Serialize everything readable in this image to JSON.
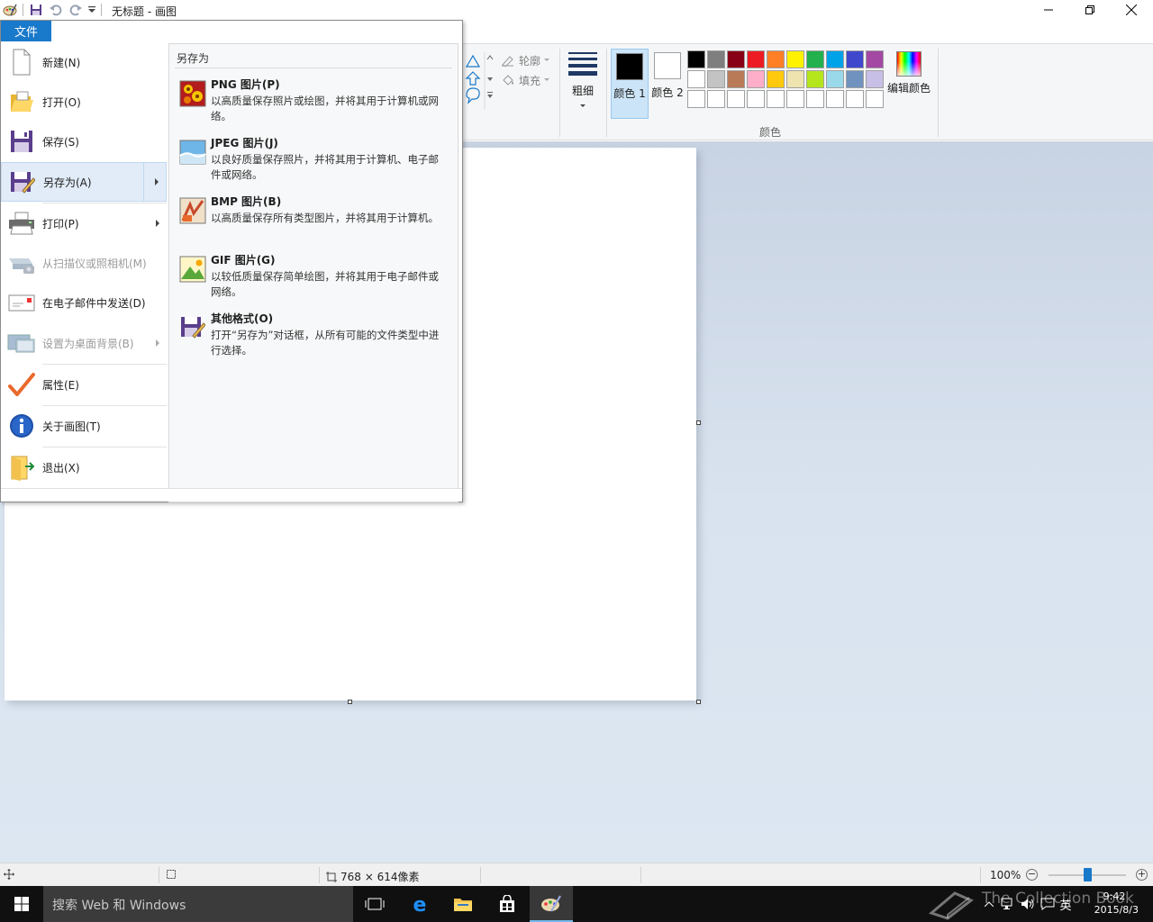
{
  "window": {
    "title": "无标题 - 画图"
  },
  "file_tab": {
    "label": "文件"
  },
  "ribbon": {
    "outline_label": "轮廓",
    "fill_label": "填充",
    "size_label": "粗细",
    "color1_label": "颜色 1",
    "color2_label": "颜色 2",
    "edit_colors_label": "编辑颜色",
    "colors_group_label": "颜色",
    "color1_value": "#000000",
    "color2_value": "#ffffff",
    "palette": [
      "#000000",
      "#7f7f7f",
      "#880015",
      "#ed1c24",
      "#ff7f27",
      "#fff200",
      "#22b14c",
      "#00a2e8",
      "#3f48cc",
      "#a349a4",
      "#ffffff",
      "#c3c3c3",
      "#b97a57",
      "#ffaec9",
      "#ffc90e",
      "#efe4b0",
      "#b5e61d",
      "#99d9ea",
      "#7092be",
      "#c8bfe7",
      "",
      "",
      "",
      "",
      "",
      "",
      "",
      "",
      "",
      ""
    ]
  },
  "file_menu": {
    "items": [
      {
        "label": "新建(N)",
        "icon": "new-file-icon"
      },
      {
        "label": "打开(O)",
        "icon": "open-folder-icon"
      },
      {
        "label": "保存(S)",
        "icon": "save-icon"
      },
      {
        "label": "另存为(A)",
        "icon": "save-as-icon"
      },
      {
        "label": "打印(P)",
        "icon": "printer-icon"
      },
      {
        "label": "从扫描仪或照相机(M)",
        "icon": "scanner-icon"
      },
      {
        "label": "在电子邮件中发送(D)",
        "icon": "email-icon"
      },
      {
        "label": "设置为桌面背景(B)",
        "icon": "desktop-icon"
      },
      {
        "label": "属性(E)",
        "icon": "checkmark-icon"
      },
      {
        "label": "关于画图(T)",
        "icon": "info-icon"
      },
      {
        "label": "退出(X)",
        "icon": "exit-icon"
      }
    ],
    "save_as": {
      "title": "另存为",
      "options": [
        {
          "title": "PNG 图片(P)",
          "desc": "以高质量保存照片或绘图，并将其用于计算机或网络。",
          "icon": "png-image-icon"
        },
        {
          "title": "JPEG 图片(J)",
          "desc": "以良好质量保存照片，并将其用于计算机、电子邮件或网络。",
          "icon": "jpeg-image-icon"
        },
        {
          "title": "BMP 图片(B)",
          "desc": "以高质量保存所有类型图片，并将其用于计算机。",
          "icon": "bmp-image-icon"
        },
        {
          "title": "GIF 图片(G)",
          "desc": "以较低质量保存简单绘图，并将其用于电子邮件或网络。",
          "icon": "gif-image-icon"
        },
        {
          "title": "其他格式(O)",
          "desc": "打开“另存为”对话框，从所有可能的文件类型中进行选择。",
          "icon": "other-formats-icon"
        }
      ]
    }
  },
  "statusbar": {
    "image_size": "768 × 614像素",
    "zoom": "100%",
    "zoom_level_percent": 100
  },
  "taskbar": {
    "search_placeholder": "搜索 Web 和 Windows",
    "time": "9:42",
    "date": "2015/8/3",
    "ime": "英",
    "watermark": "The Collection Book"
  }
}
